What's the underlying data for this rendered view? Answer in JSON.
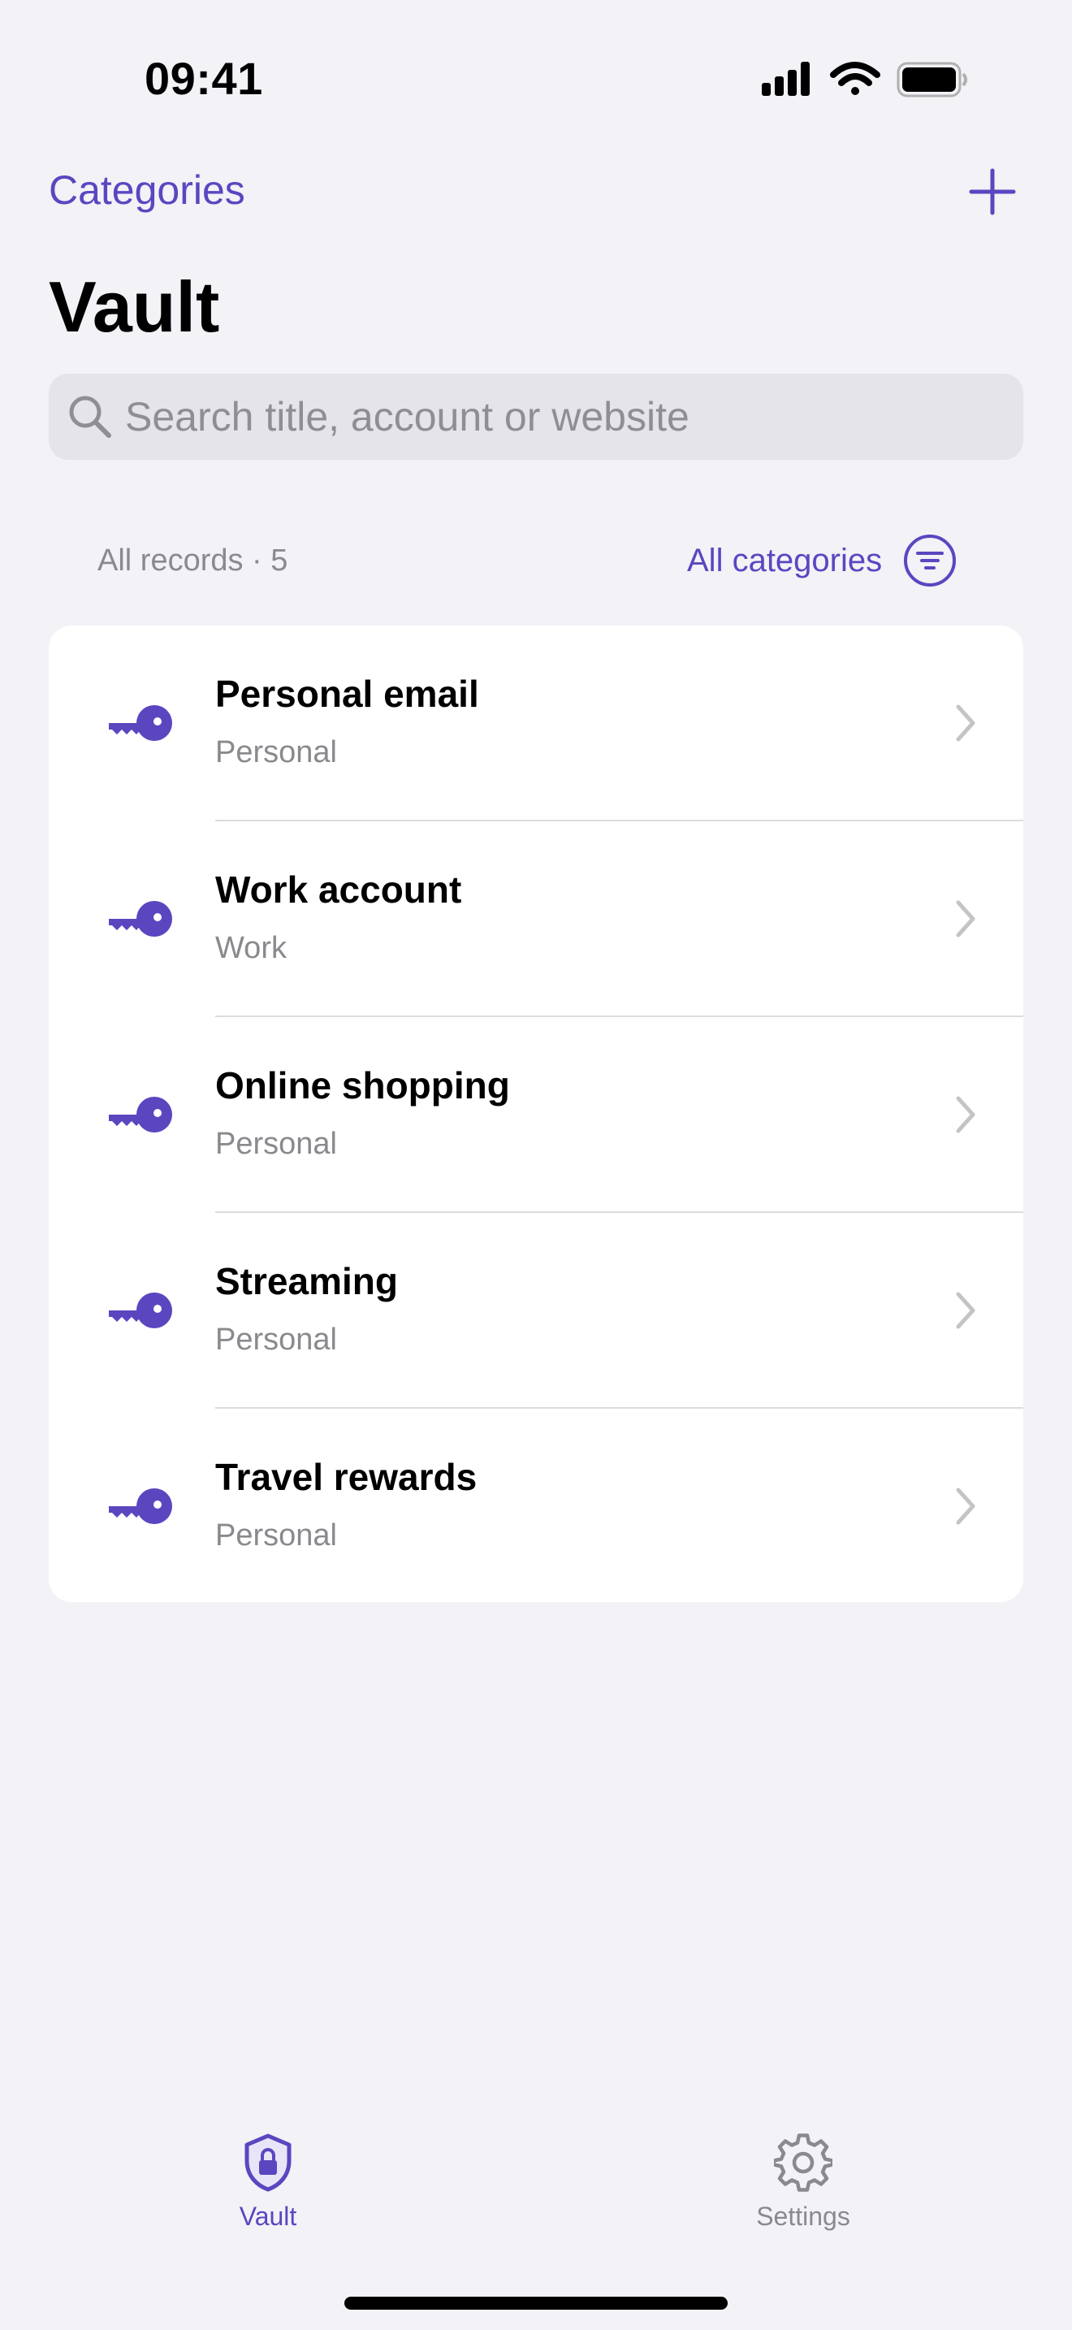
{
  "status_bar": {
    "time": "09:41"
  },
  "nav": {
    "back_label": "Categories",
    "add_icon": "plus-icon",
    "title": "Vault"
  },
  "search": {
    "placeholder": "Search title, account or website",
    "value": ""
  },
  "list_header": {
    "count_label": "All records · 5",
    "filter_label": "All categories",
    "filter_icon": "filter-icon"
  },
  "records": [
    {
      "title": "Personal email",
      "category": "Personal",
      "icon": "key-icon"
    },
    {
      "title": "Work account",
      "category": "Work",
      "icon": "key-icon"
    },
    {
      "title": "Online shopping",
      "category": "Personal",
      "icon": "key-icon"
    },
    {
      "title": "Streaming",
      "category": "Personal",
      "icon": "key-icon"
    },
    {
      "title": "Travel rewards",
      "category": "Personal",
      "icon": "key-icon"
    }
  ],
  "tab_bar": {
    "tabs": [
      {
        "label": "Vault",
        "icon": "shield-lock-icon",
        "selected": true
      },
      {
        "label": "Settings",
        "icon": "gear-icon",
        "selected": false
      }
    ]
  },
  "colors": {
    "accent": "#5b46c0",
    "background": "#f2f2f7",
    "secondary_text": "#8a8a8e"
  }
}
